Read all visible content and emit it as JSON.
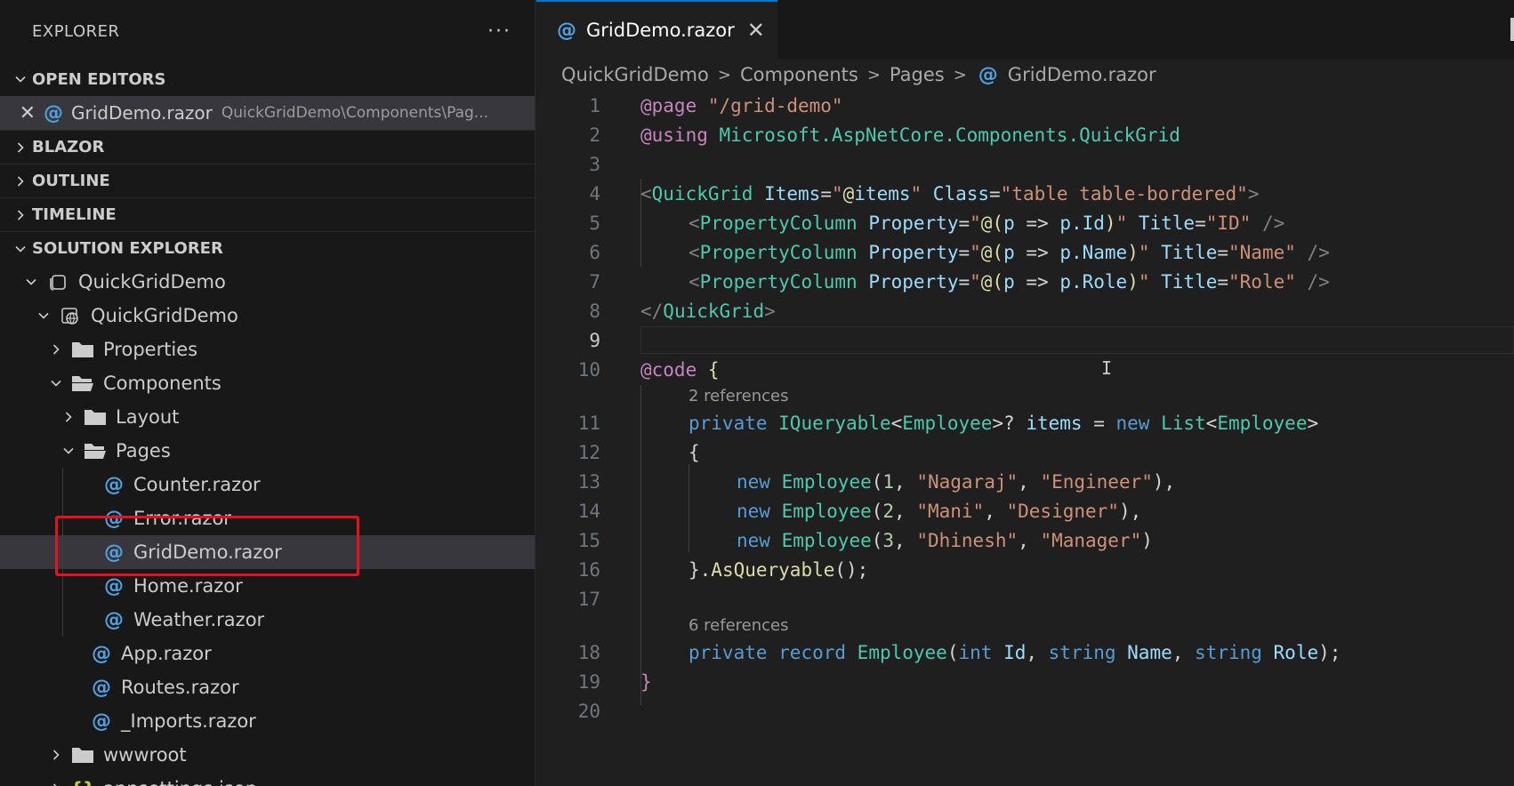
{
  "sidebar": {
    "title": "EXPLORER",
    "more": "···",
    "sections": {
      "open_editors": "OPEN EDITORS",
      "blazor": "BLAZOR",
      "outline": "OUTLINE",
      "timeline": "TIMELINE",
      "solution_explorer": "SOLUTION EXPLORER"
    },
    "open_editor": {
      "close": "✕",
      "file": "GridDemo.razor",
      "path": "QuickGridDemo\\Components\\Pag..."
    },
    "tree": {
      "solution": "QuickGridDemo",
      "project": "QuickGridDemo",
      "properties": "Properties",
      "components": "Components",
      "layout": "Layout",
      "pages": "Pages",
      "counter": "Counter.razor",
      "error": "Error.razor",
      "griddemo": "GridDemo.razor",
      "home": "Home.razor",
      "weather": "Weather.razor",
      "app": "App.razor",
      "routes": "Routes.razor",
      "imports": "_Imports.razor",
      "wwwroot": "wwwroot",
      "appsettings": "appsettings.json"
    }
  },
  "editor": {
    "tab": {
      "label": "GridDemo.razor",
      "close": "✕"
    },
    "breadcrumb": [
      "QuickGridDemo",
      "Components",
      "Pages",
      "GridDemo.razor"
    ],
    "codelens": {
      "refs_code": "2 references",
      "refs_record": "6 references"
    },
    "line_numbers": [
      "1",
      "2",
      "3",
      "4",
      "5",
      "6",
      "7",
      "8",
      "9",
      "10",
      "11",
      "12",
      "13",
      "14",
      "15",
      "16",
      "17",
      "18",
      "19",
      "20"
    ],
    "code": {
      "l1_dir": "@page",
      "l1_str": " \"/grid-demo\"",
      "l2_dir": "@using",
      "l2_ns": " Microsoft.AspNetCore.Components.QuickGrid",
      "l4_open": "<",
      "l4_tag": "QuickGrid",
      "l4_attr1": " Items",
      "l4_eq1": "=",
      "l4_q1": "\"",
      "l4_at": "@",
      "l4_items": "items",
      "l4_q2": "\"",
      "l4_attr2": " Class",
      "l4_eq2": "=",
      "l4_val2": "\"table table-bordered\"",
      "l4_close": ">",
      "pc_open": "<",
      "pc_tag": "PropertyColumn",
      "pc_prop": " Property",
      "pc_eq": "=",
      "pc_q": "\"",
      "pc_at": "@(",
      "pc_p": "p",
      "pc_arrow": " => ",
      "pc_pdot": "p.",
      "l5_member": "Id",
      "l6_member": "Name",
      "l7_member": "Role",
      "pc_rparen": ")",
      "pc_title": " Title",
      "l5_title": "\"ID\"",
      "l6_title": "\"Name\"",
      "l7_title": "\"Role\"",
      "pc_end": " />",
      "l8_close_open": "</",
      "l8_tag": "QuickGrid",
      "l8_close": ">",
      "l10_dir": "@code",
      "l10_brace": " {",
      "l11_private": "private",
      "l11_type": " IQueryable",
      "l11_lt": "<",
      "l11_emp": "Employee",
      "l11_gt": ">? ",
      "l11_items": "items",
      "l11_eq": " = ",
      "l11_new": "new",
      "l11_list": " List",
      "l11_lt2": "<",
      "l11_emp2": "Employee",
      "l11_gt2": ">",
      "l12_brace": "{",
      "new_kw": "new",
      "emp_ctor": " Employee",
      "l13_args_open": "(",
      "l13_num": "1",
      "l13_c1": ", ",
      "l13_s1": "\"Nagaraj\"",
      "l13_c2": ", ",
      "l13_s2": "\"Engineer\"",
      "l13_end": "),",
      "l14_num": "2",
      "l14_s1": "\"Mani\"",
      "l14_s2": "\"Designer\"",
      "l14_end": "),",
      "l15_num": "3",
      "l15_s1": "\"Dhinesh\"",
      "l15_s2": "\"Manager\"",
      "l15_end": ")",
      "l16_brace": "}.",
      "l16_fn": "AsQueryable",
      "l16_end": "();",
      "l18_private": "private",
      "l18_record": " record",
      "l18_emp": " Employee",
      "l18_lp": "(",
      "l18_int": "int",
      "l18_id": " Id",
      "l18_c1": ", ",
      "l18_string1": "string",
      "l18_name": " Name",
      "l18_c2": ", ",
      "l18_string2": "string",
      "l18_role": " Role",
      "l18_end": ");",
      "l19_brace": "}"
    }
  },
  "colors": {
    "accent": "#0078d4",
    "razor_icon": "#4fa1e0",
    "highlight": "#e81123"
  }
}
